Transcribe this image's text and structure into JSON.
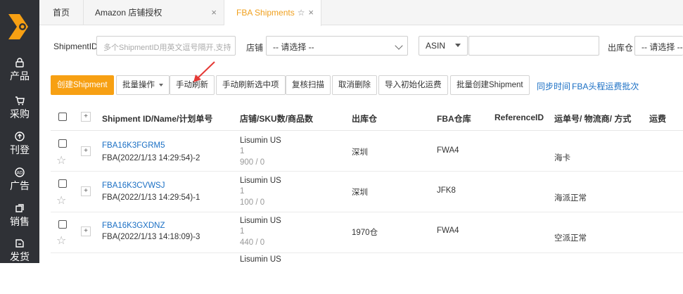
{
  "sidebar": {
    "logo": "logo",
    "items": [
      {
        "label": "产品",
        "icon": "lock-icon"
      },
      {
        "label": "采购",
        "icon": "cart-icon"
      },
      {
        "label": "刊登",
        "icon": "upload-icon"
      },
      {
        "label": "广告",
        "icon": "ad-icon"
      },
      {
        "label": "销售",
        "icon": "sales-icon"
      },
      {
        "label": "发货",
        "icon": "shipping-icon"
      }
    ]
  },
  "tabs": [
    {
      "label": "首页"
    },
    {
      "label": "Amazon 店铺授权"
    },
    {
      "label": "FBA Shipments",
      "active": true
    }
  ],
  "filters": {
    "shipment_label": "ShipmentID",
    "shipment_placeholder": "多个ShipmentID用英文逗号隔开,支持",
    "store_label": "店铺",
    "store_value": "-- 请选择 --",
    "asin_value": "ASIN",
    "warehouse_label": "出库仓",
    "warehouse_value": "-- 请选择 --"
  },
  "toolbar": {
    "create": "创建Shipment",
    "batch": "批量操作",
    "refresh": "手动刷新",
    "refresh_selected": "手动刷新选中项",
    "recheck": "复核扫描",
    "cancel_delete": "取消删除",
    "import_freight": "导入初始化运费",
    "batch_create": "批量创建Shipment",
    "sync_time": "同步时间",
    "fba_batch": "FBA头程运费批次"
  },
  "table": {
    "headers": {
      "id": "Shipment ID/Name/计划单号",
      "store": "店铺/SKU数/商品数",
      "warehouse": "出库仓",
      "fba": "FBA仓库",
      "ref": "ReferenceID",
      "tracking": "运单号/ 物流商/ 方式",
      "freight": "运费"
    },
    "rows": [
      {
        "id": "FBA16K3FGRM5",
        "name": "FBA(2022/1/13 14:29:54)-2",
        "store": "Lisumin US",
        "sku": "1",
        "qty": "900 / 0",
        "warehouse": "深圳",
        "fba": "FWA4",
        "method": "海卡"
      },
      {
        "id": "FBA16K3CVWSJ",
        "name": "FBA(2022/1/13 14:29:54)-1",
        "store": "Lisumin US",
        "sku": "1",
        "qty": "100 / 0",
        "warehouse": "深圳",
        "fba": "JFK8",
        "method": "海派正常"
      },
      {
        "id": "FBA16K3GXDNZ",
        "name": "FBA(2022/1/13 14:18:09)-3",
        "store": "Lisumin US",
        "sku": "1",
        "qty": "440 / 0",
        "warehouse": "1970仓",
        "fba": "FWA4",
        "method": "空派正常"
      },
      {
        "id": "",
        "name": "",
        "store": "Lisumin US",
        "sku": "",
        "qty": "",
        "warehouse": "",
        "fba": "",
        "method": ""
      }
    ]
  },
  "colors": {
    "accent": "#f7a013",
    "link": "#1a6fc4",
    "sidebar": "#2f3136",
    "annotation": "#e53935"
  }
}
